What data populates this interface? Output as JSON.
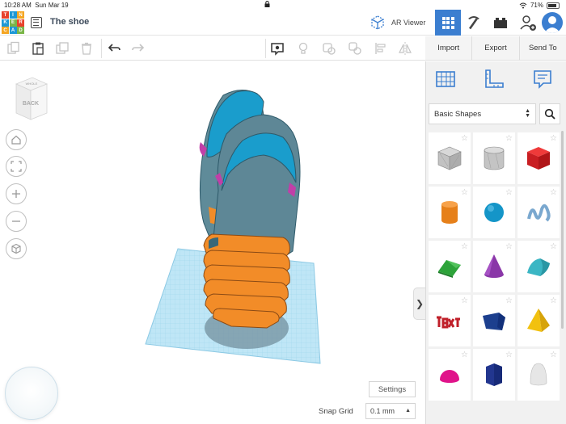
{
  "status_bar": {
    "time": "10:28 AM",
    "date": "Sun Mar 19",
    "battery": "71%"
  },
  "header": {
    "logo_letters": [
      "T",
      "I",
      "N",
      "K",
      "E",
      "R",
      "C",
      "A",
      "D"
    ],
    "design_title": "The shoe",
    "ar_viewer_label": "AR Viewer"
  },
  "toolbar": {
    "actions": {
      "import": "Import",
      "export": "Export",
      "send_to": "Send To"
    }
  },
  "viewcube": {
    "top_face": "WHOLE",
    "front_face": "BACK"
  },
  "workplane": {
    "settings_label": "Settings",
    "snap_grid_label": "Snap Grid",
    "snap_grid_value": "0.1 mm"
  },
  "panel": {
    "category": "Basic Shapes",
    "shapes": [
      "Box Hole",
      "Cylinder Hole",
      "Box",
      "Cylinder",
      "Sphere",
      "Scribble",
      "Roof",
      "Cone",
      "Round Roof",
      "Text",
      "Wedge",
      "Pyramid",
      "Half Sphere",
      "Polygon",
      "Paraboloid"
    ]
  },
  "colors": {
    "accent": "#3b7ed0",
    "workplane_grid": "#8fd0ec",
    "shoe_orange": "#f28c28",
    "shoe_teal": "#1a9dcc"
  }
}
